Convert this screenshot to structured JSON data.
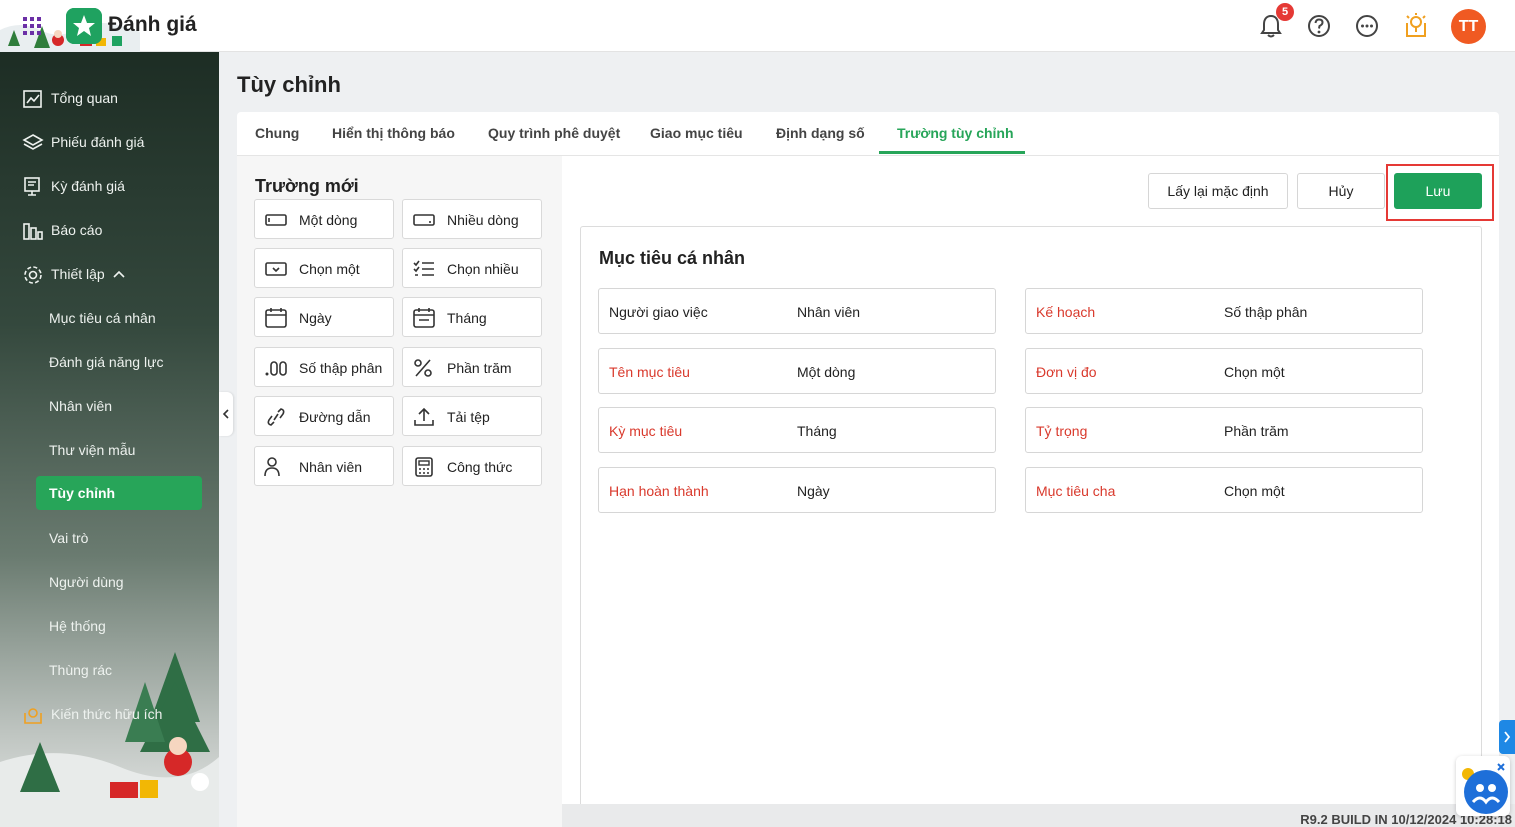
{
  "app": {
    "title": "Đánh giá",
    "notification_count": "5",
    "avatar_initials": "TT"
  },
  "sidebar": {
    "items": [
      {
        "label": "Tổng quan",
        "icon": "chart-line-icon"
      },
      {
        "label": "Phiếu đánh giá",
        "icon": "layers-icon"
      },
      {
        "label": "Kỳ đánh giá",
        "icon": "monitor-icon"
      },
      {
        "label": "Báo cáo",
        "icon": "bar-chart-icon"
      },
      {
        "label": "Thiết lập",
        "icon": "gear-icon"
      }
    ],
    "sub_items": [
      {
        "label": "Mục tiêu cá nhân"
      },
      {
        "label": "Đánh giá năng lực"
      },
      {
        "label": "Nhân viên"
      },
      {
        "label": "Thư viện mẫu"
      },
      {
        "label": "Tùy chỉnh",
        "active": true
      },
      {
        "label": "Vai trò"
      },
      {
        "label": "Người dùng"
      },
      {
        "label": "Hệ thống"
      },
      {
        "label": "Thùng rác"
      }
    ],
    "knowledge": {
      "label": "Kiến thức hữu ích",
      "icon": "lightbulb-map-icon"
    }
  },
  "page": {
    "title": "Tùy chỉnh"
  },
  "tabs": [
    {
      "label": "Chung"
    },
    {
      "label": "Hiển thị thông báo"
    },
    {
      "label": "Quy trình phê duyệt"
    },
    {
      "label": "Giao mục tiêu"
    },
    {
      "label": "Định dạng số"
    },
    {
      "label": "Trường tùy chỉnh",
      "active": true
    }
  ],
  "new_fields": {
    "title": "Trường mới",
    "types": [
      {
        "label": "Một dòng",
        "icon": "single-line-icon"
      },
      {
        "label": "Nhiều dòng",
        "icon": "multi-line-icon"
      },
      {
        "label": "Chọn một",
        "icon": "dropdown-icon"
      },
      {
        "label": "Chọn nhiều",
        "icon": "checklist-icon"
      },
      {
        "label": "Ngày",
        "icon": "calendar-icon"
      },
      {
        "label": "Tháng",
        "icon": "calendar-month-icon"
      },
      {
        "label": "Số thập phân",
        "icon": "decimal-icon"
      },
      {
        "label": "Phần trăm",
        "icon": "percent-icon"
      },
      {
        "label": "Đường dẫn",
        "icon": "link-icon"
      },
      {
        "label": "Tải tệp",
        "icon": "upload-icon"
      },
      {
        "label": "Nhân viên",
        "icon": "user-icon"
      },
      {
        "label": "Công thức",
        "icon": "calculator-icon"
      }
    ]
  },
  "actions": {
    "reset_label": "Lấy lại mặc định",
    "cancel_label": "Hủy",
    "save_label": "Lưu"
  },
  "form": {
    "title": "Mục tiêu cá nhân",
    "left_fields": [
      {
        "name": "Người giao việc",
        "type": "Nhân viên",
        "required": false
      },
      {
        "name": "Tên mục tiêu",
        "type": "Một dòng",
        "required": true
      },
      {
        "name": "Kỳ mục tiêu",
        "type": "Tháng",
        "required": true
      },
      {
        "name": "Hạn hoàn thành",
        "type": "Ngày",
        "required": true
      }
    ],
    "right_fields": [
      {
        "name": "Kế hoạch",
        "type": "Số thập phân",
        "required": true
      },
      {
        "name": "Đơn vị đo",
        "type": "Chọn một",
        "required": true
      },
      {
        "name": "Tỷ trọng",
        "type": "Phần trăm",
        "required": true
      },
      {
        "name": "Mục tiêu cha",
        "type": "Chọn một",
        "required": true
      }
    ]
  },
  "footer": {
    "build": "R9.2 BUILD IN 10/12/2024 10:28:18"
  },
  "colors": {
    "accent": "#27a559",
    "required": "#d9392c",
    "highlight": "#e53935",
    "avatar": "#f05a22"
  }
}
